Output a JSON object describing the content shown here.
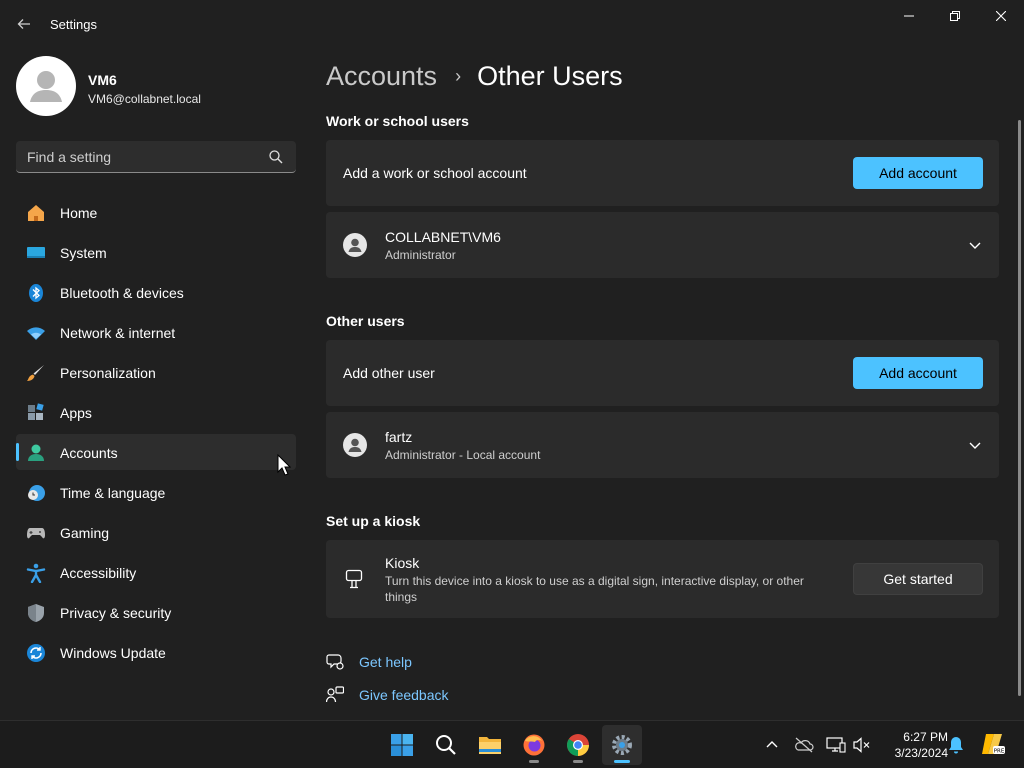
{
  "window": {
    "title": "Settings"
  },
  "profile": {
    "name": "VM6",
    "email": "VM6@collabnet.local"
  },
  "search": {
    "placeholder": "Find a setting"
  },
  "nav": {
    "items": [
      {
        "label": "Home",
        "icon": "home-icon"
      },
      {
        "label": "System",
        "icon": "system-icon"
      },
      {
        "label": "Bluetooth & devices",
        "icon": "bluetooth-icon"
      },
      {
        "label": "Network & internet",
        "icon": "wifi-icon"
      },
      {
        "label": "Personalization",
        "icon": "brush-icon"
      },
      {
        "label": "Apps",
        "icon": "apps-icon"
      },
      {
        "label": "Accounts",
        "icon": "accounts-icon",
        "active": true
      },
      {
        "label": "Time & language",
        "icon": "clock-globe-icon"
      },
      {
        "label": "Gaming",
        "icon": "gamepad-icon"
      },
      {
        "label": "Accessibility",
        "icon": "accessibility-icon"
      },
      {
        "label": "Privacy & security",
        "icon": "shield-icon"
      },
      {
        "label": "Windows Update",
        "icon": "update-icon"
      }
    ]
  },
  "breadcrumb": {
    "parent": "Accounts",
    "separator": "›",
    "current": "Other Users"
  },
  "work": {
    "title": "Work or school users",
    "add_text": "Add a work or school account",
    "add_button": "Add account",
    "user": {
      "name": "COLLABNET\\VM6",
      "role": "Administrator"
    }
  },
  "other": {
    "title": "Other users",
    "add_text": "Add other user",
    "add_button": "Add account",
    "user": {
      "name": "fartz",
      "role": "Administrator - Local account"
    }
  },
  "kiosk": {
    "title": "Set up a kiosk",
    "name": "Kiosk",
    "description": "Turn this device into a kiosk to use as a digital sign, interactive display, or other things",
    "button": "Get started"
  },
  "help": {
    "get_help": "Get help",
    "give_feedback": "Give feedback"
  },
  "taskbar": {
    "apps": [
      "start-icon",
      "search-icon",
      "file-explorer-icon",
      "firefox-icon",
      "chrome-icon",
      "settings-icon"
    ],
    "tray": [
      "chevron-up-icon",
      "onedrive-icon",
      "network-icon",
      "volume-muted-icon",
      "notification-bell-icon",
      "copilot-icon"
    ],
    "time": "6:27 PM",
    "date": "3/23/2024"
  },
  "colors": {
    "accent": "#4cc2ff",
    "background": "#202020",
    "card": "#2b2b2b",
    "link": "#7cc7ff"
  }
}
